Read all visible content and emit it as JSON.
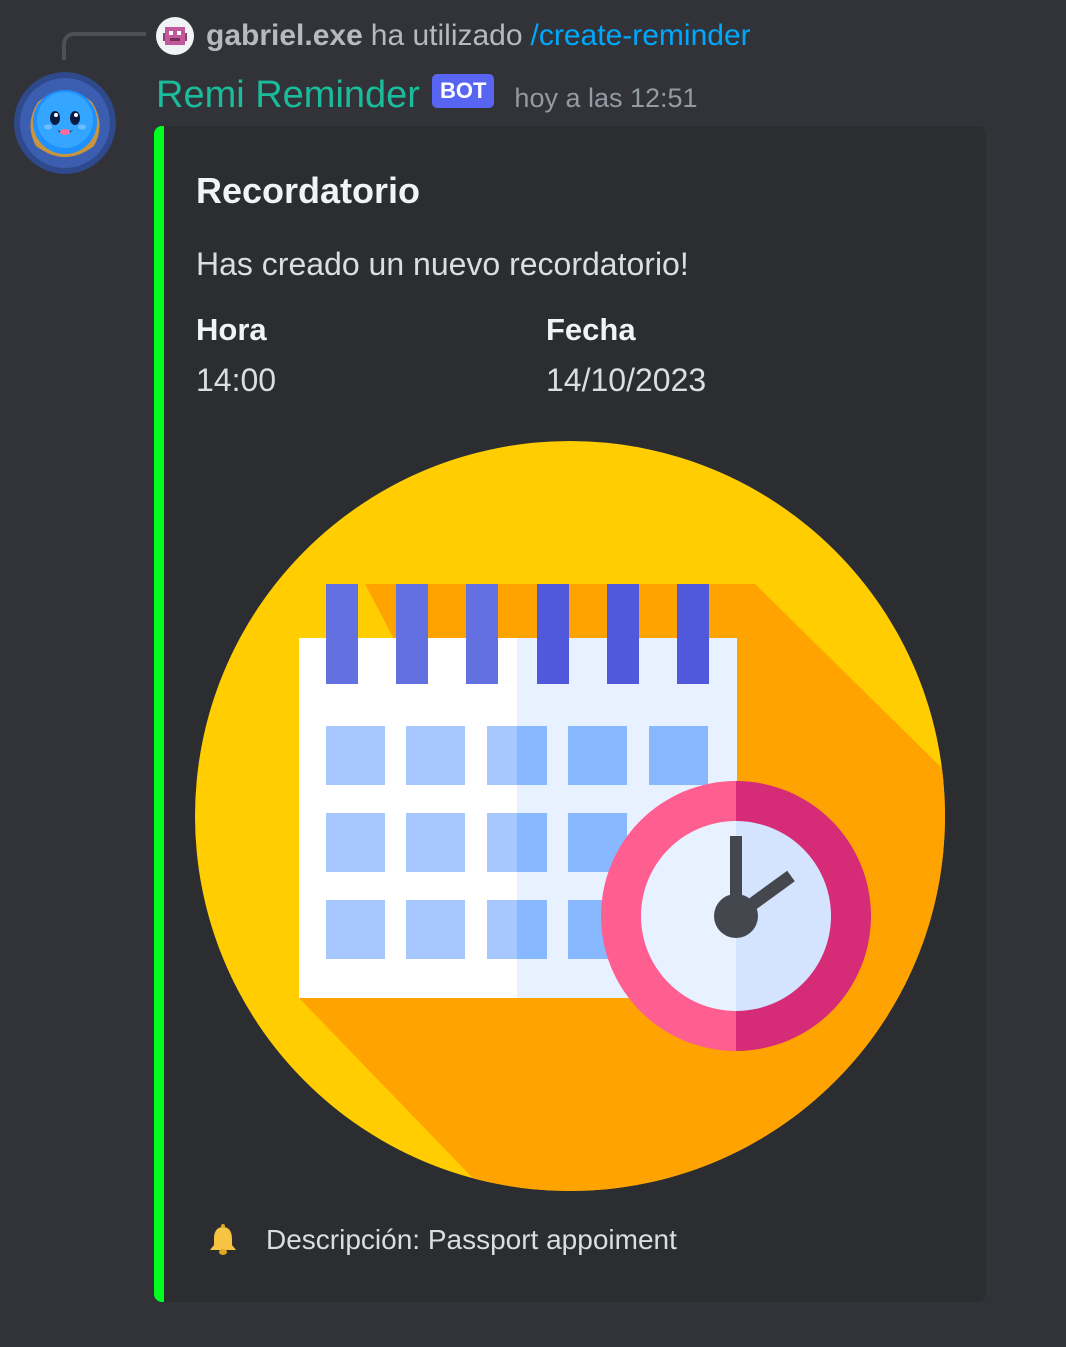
{
  "command_reply": {
    "user": "gabriel.exe",
    "action": "ha utilizado",
    "command": "/create-reminder"
  },
  "message": {
    "author": "Remi Reminder",
    "badge": "BOT",
    "timestamp": "hoy a las 12:51"
  },
  "embed": {
    "accent_color": "#00ff1e",
    "title": "Recordatorio",
    "description": "Has creado un nuevo recordatorio!",
    "fields": [
      {
        "name": "Hora",
        "value": "14:00"
      },
      {
        "name": "Fecha",
        "value": "14/10/2023"
      }
    ],
    "image": "calendar-clock-illustration",
    "footer_icon": "bell-icon",
    "footer_text": "Descripción: Passport appoiment"
  },
  "colors": {
    "background": "#313338",
    "embed_background": "#2b2d31",
    "bot_name": "#1abc9c",
    "badge": "#5865f2",
    "command": "#00a8fc"
  }
}
